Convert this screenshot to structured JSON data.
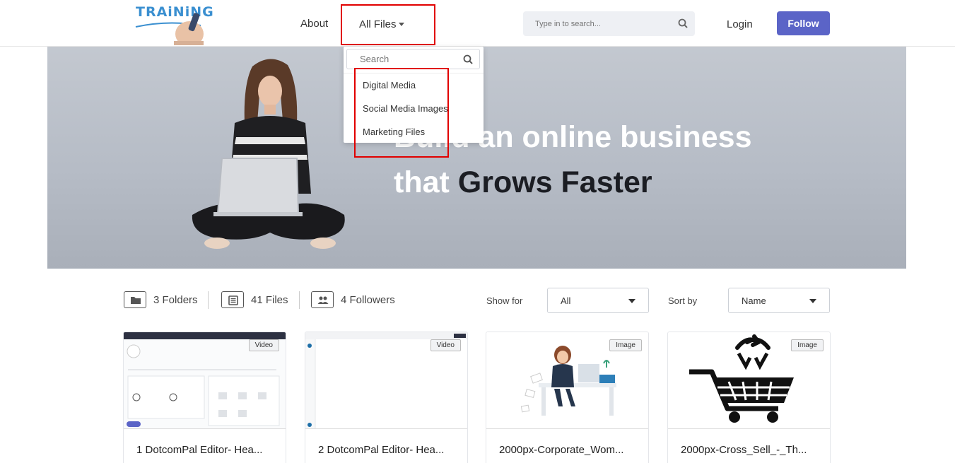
{
  "header": {
    "logo_text": "TRAiNiNG",
    "nav_about": "About",
    "nav_all_files": "All Files",
    "search_placeholder": "Type in to search...",
    "login": "Login",
    "follow": "Follow"
  },
  "dropdown": {
    "search_placeholder": "Search",
    "items": [
      "Digital Media",
      "Social Media Images",
      "Marketing Files"
    ]
  },
  "hero": {
    "line1": "Build an online business",
    "line2_prefix": "that ",
    "line2_highlight": "Grows Faster"
  },
  "filters": {
    "folders": "3 Folders",
    "files": "41 Files",
    "followers": "4 Followers",
    "show_for_label": "Show for",
    "show_for_value": "All",
    "sort_by_label": "Sort by",
    "sort_by_value": "Name"
  },
  "cards": [
    {
      "badge": "Video",
      "title": "1 DotcomPal Editor- Hea..."
    },
    {
      "badge": "Video",
      "title": "2 DotcomPal Editor- Hea..."
    },
    {
      "badge": "Image",
      "title": "2000px-Corporate_Wom..."
    },
    {
      "badge": "Image",
      "title": "2000px-Cross_Sell_-_Th..."
    }
  ],
  "colors": {
    "accent": "#5b64c7",
    "highlight_box": "#e10000",
    "hero_dark_text": "#1b1d23"
  }
}
